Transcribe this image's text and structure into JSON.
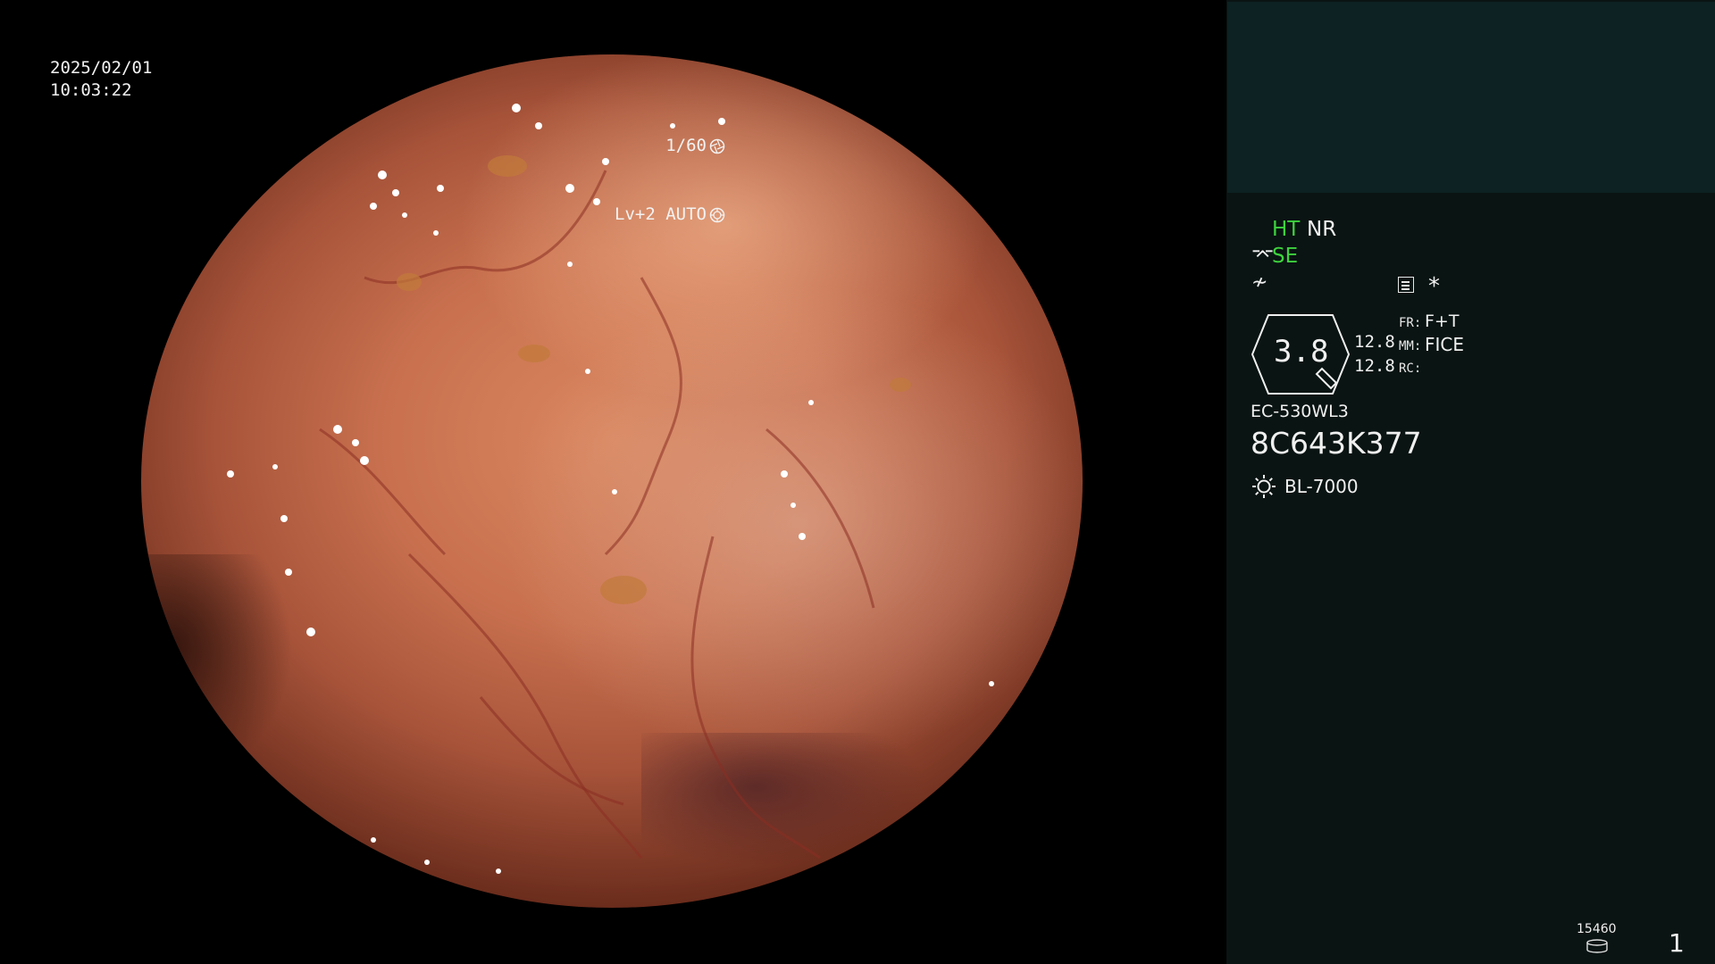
{
  "overlay": {
    "date": "2025/02/01",
    "time": "10:03:22",
    "shutter": "1/60",
    "level": "Lv+2 AUTO"
  },
  "panel": {
    "ht": "HT",
    "nr": "NR",
    "se": "SE",
    "zoom": "3.8",
    "zoom_val_1": "12.8",
    "zoom_val_2": "12.8",
    "fr_label": "FR:",
    "fr_value": "F+T",
    "mm_label": "MM:",
    "mm_value": "FICE",
    "rc_label": "RC:",
    "scope_model": "EC-530WL3",
    "serial": "8C643K377",
    "light_source": "BL-7000",
    "counter": "15460",
    "page": "1"
  },
  "icons": [
    "shutter-icon",
    "iris-icon",
    "scope-se-icon",
    "zigzag-icon",
    "memo-icon",
    "asterisk-icon",
    "zoom-frame-icon",
    "light-source-icon",
    "disk-icon"
  ]
}
